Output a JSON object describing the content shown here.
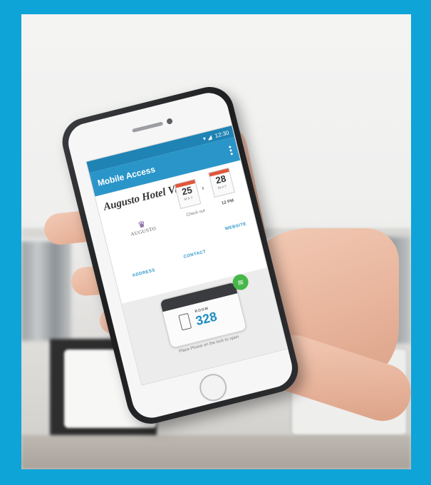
{
  "status_bar": {
    "time": "12:30"
  },
  "app_bar": {
    "title": "Mobile Access",
    "menu_icon": "more-vert-icon"
  },
  "hotel": {
    "name": "Augusto Hotel Villa",
    "logo_text": "AUGUSTO",
    "logo_icon": "crown-icon"
  },
  "check_in": {
    "day": "25",
    "month": "MAY"
  },
  "check_out": {
    "day": "28",
    "month": "MAY",
    "label": "Check out",
    "time": "12 PM"
  },
  "links": {
    "address": "ADDRESS",
    "contact": "CONTACT",
    "website": "WEBSITE"
  },
  "lock": {
    "room_label": "ROOM",
    "room_number": "328",
    "instruction": "Place Phone on the lock to open",
    "badge_icon": "wifi-icon",
    "badge_color": "#47b749"
  },
  "colors": {
    "accent": "#2a95c9",
    "frame": "#0ea4d8",
    "date_top": "#e0563b"
  }
}
